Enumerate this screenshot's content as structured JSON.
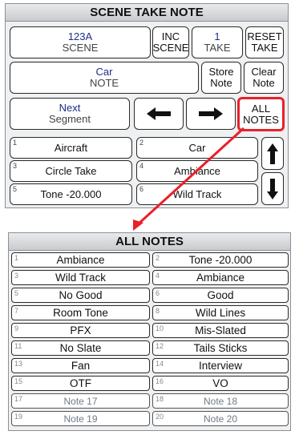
{
  "top_panel": {
    "title": "SCENE TAKE NOTE",
    "scene": {
      "value": "123A",
      "label": "SCENE"
    },
    "inc_scene": {
      "top": "INC",
      "bottom": "SCENE"
    },
    "take": {
      "value": "1",
      "label": "TAKE"
    },
    "reset_take": {
      "top": "RESET",
      "bottom": "TAKE"
    },
    "note": {
      "value": "Car",
      "label": "NOTE"
    },
    "store_note": {
      "top": "Store",
      "bottom": "Note"
    },
    "clear_note": {
      "top": "Clear",
      "bottom": "Note"
    },
    "next_segment": {
      "top": "Next",
      "bottom": "Segment"
    },
    "all_notes": {
      "top": "ALL",
      "bottom": "NOTES"
    },
    "slots": [
      {
        "num": "1",
        "label": "Aircraft"
      },
      {
        "num": "2",
        "label": "Car"
      },
      {
        "num": "3",
        "label": "Circle Take"
      },
      {
        "num": "4",
        "label": "Ambiance"
      },
      {
        "num": "5",
        "label": "Tone -20.000"
      },
      {
        "num": "6",
        "label": "Wild Track"
      }
    ],
    "icons": {
      "left": "arrow-left-icon",
      "right": "arrow-right-icon",
      "up": "arrow-up-icon",
      "down": "arrow-down-icon"
    },
    "highlight_color": "#e8202a"
  },
  "all_notes_panel": {
    "title": "ALL NOTES",
    "notes": [
      {
        "num": "1",
        "label": "Ambiance"
      },
      {
        "num": "2",
        "label": "Tone -20.000"
      },
      {
        "num": "3",
        "label": "Wild Track"
      },
      {
        "num": "4",
        "label": "Ambiance"
      },
      {
        "num": "5",
        "label": "No Good"
      },
      {
        "num": "6",
        "label": "Good"
      },
      {
        "num": "7",
        "label": "Room Tone"
      },
      {
        "num": "8",
        "label": "Wild Lines"
      },
      {
        "num": "9",
        "label": "PFX"
      },
      {
        "num": "10",
        "label": "Mis-Slated"
      },
      {
        "num": "11",
        "label": "No Slate"
      },
      {
        "num": "12",
        "label": "Tails Sticks"
      },
      {
        "num": "13",
        "label": "Fan"
      },
      {
        "num": "14",
        "label": "Interview"
      },
      {
        "num": "15",
        "label": "OTF"
      },
      {
        "num": "16",
        "label": "VO"
      },
      {
        "num": "17",
        "label": "Note 17"
      },
      {
        "num": "18",
        "label": "Note 18"
      },
      {
        "num": "19",
        "label": "Note 19"
      },
      {
        "num": "20",
        "label": "Note 20"
      }
    ]
  }
}
